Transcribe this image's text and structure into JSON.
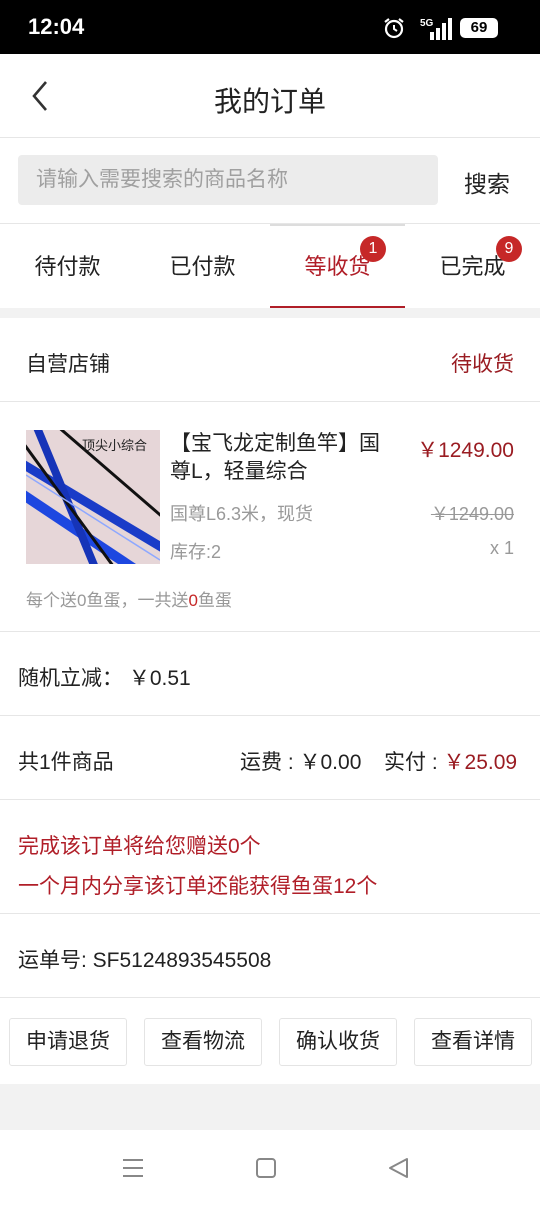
{
  "status_bar": {
    "time": "12:04",
    "network": "5G",
    "battery": "69"
  },
  "header": {
    "title": "我的订单"
  },
  "search": {
    "placeholder": "请输入需要搜索的商品名称",
    "button_label": "搜索"
  },
  "tabs": [
    {
      "label": "待付款",
      "badge": null,
      "active": false
    },
    {
      "label": "已付款",
      "badge": null,
      "active": false
    },
    {
      "label": "等收货",
      "badge": "1",
      "active": true
    },
    {
      "label": "已完成",
      "badge": "9",
      "active": false
    }
  ],
  "order": {
    "shop_name": "自营店铺",
    "status": "待收货",
    "product": {
      "image_caption": "顶尖小综合",
      "title": "【宝飞龙定制鱼竿】国尊L，轻量综合",
      "price": "￥1249.00",
      "spec": "国尊L6.3米，现货",
      "original_price": "￥1249.00",
      "stock": "库存:2",
      "quantity": "x 1",
      "bonus_prefix": "每个送0鱼蛋，一共送",
      "bonus_value": "0",
      "bonus_suffix": "鱼蛋"
    },
    "discount": "随机立减： ￥0.51",
    "item_count": "共1件商品",
    "shipping_fee": "运费 : ￥0.00",
    "paid_label": "实付 : ",
    "paid_value": "￥25.09",
    "gift_line1": "完成该订单将给您赠送0个",
    "gift_line2": "一个月内分享该订单还能获得鱼蛋12个",
    "tracking": "运单号: SF5124893545508",
    "actions": [
      "申请退货",
      "查看物流",
      "确认收货",
      "查看详情"
    ]
  },
  "colors": {
    "accent": "#b01e28",
    "badge": "#c62828"
  },
  "icons": {
    "back": "chevron-left-icon",
    "nav": [
      "menu-icon",
      "home-square-icon",
      "back-triangle-icon"
    ]
  }
}
